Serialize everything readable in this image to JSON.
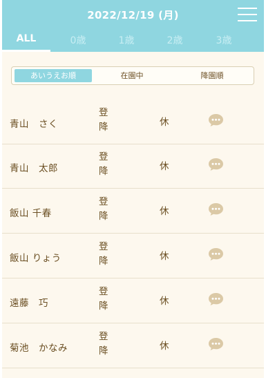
{
  "header": {
    "date": "2022/12/19 (月)",
    "tabs": [
      "ALL",
      "0歳",
      "1歳",
      "2歳",
      "3歳"
    ],
    "active_tab": 0
  },
  "sort": {
    "options": [
      "あいうえお順",
      "在園中",
      "降園順"
    ],
    "active": 0
  },
  "rows": [
    {
      "name": "青山　さく",
      "arrive": "登",
      "leave": "降",
      "absent": "休"
    },
    {
      "name": "青山　太郎",
      "arrive": "登",
      "leave": "降",
      "absent": "休"
    },
    {
      "name": "飯山 千春",
      "arrive": "登",
      "leave": "降",
      "absent": "休"
    },
    {
      "name": "飯山 りょう",
      "arrive": "登",
      "leave": "降",
      "absent": "休"
    },
    {
      "name": "遠藤　巧",
      "arrive": "登",
      "leave": "降",
      "absent": "休"
    },
    {
      "name": "菊池　かなみ",
      "arrive": "登",
      "leave": "降",
      "absent": "休"
    }
  ],
  "icons": {
    "menu": "hamburger-menu-icon",
    "chat": "speech-bubble-icon"
  },
  "colors": {
    "header": "#8fd6e0",
    "background": "#fdf8ee",
    "text": "#6b4f23",
    "chat_icon": "#dbc9a6",
    "divider": "#e7dfcb"
  }
}
